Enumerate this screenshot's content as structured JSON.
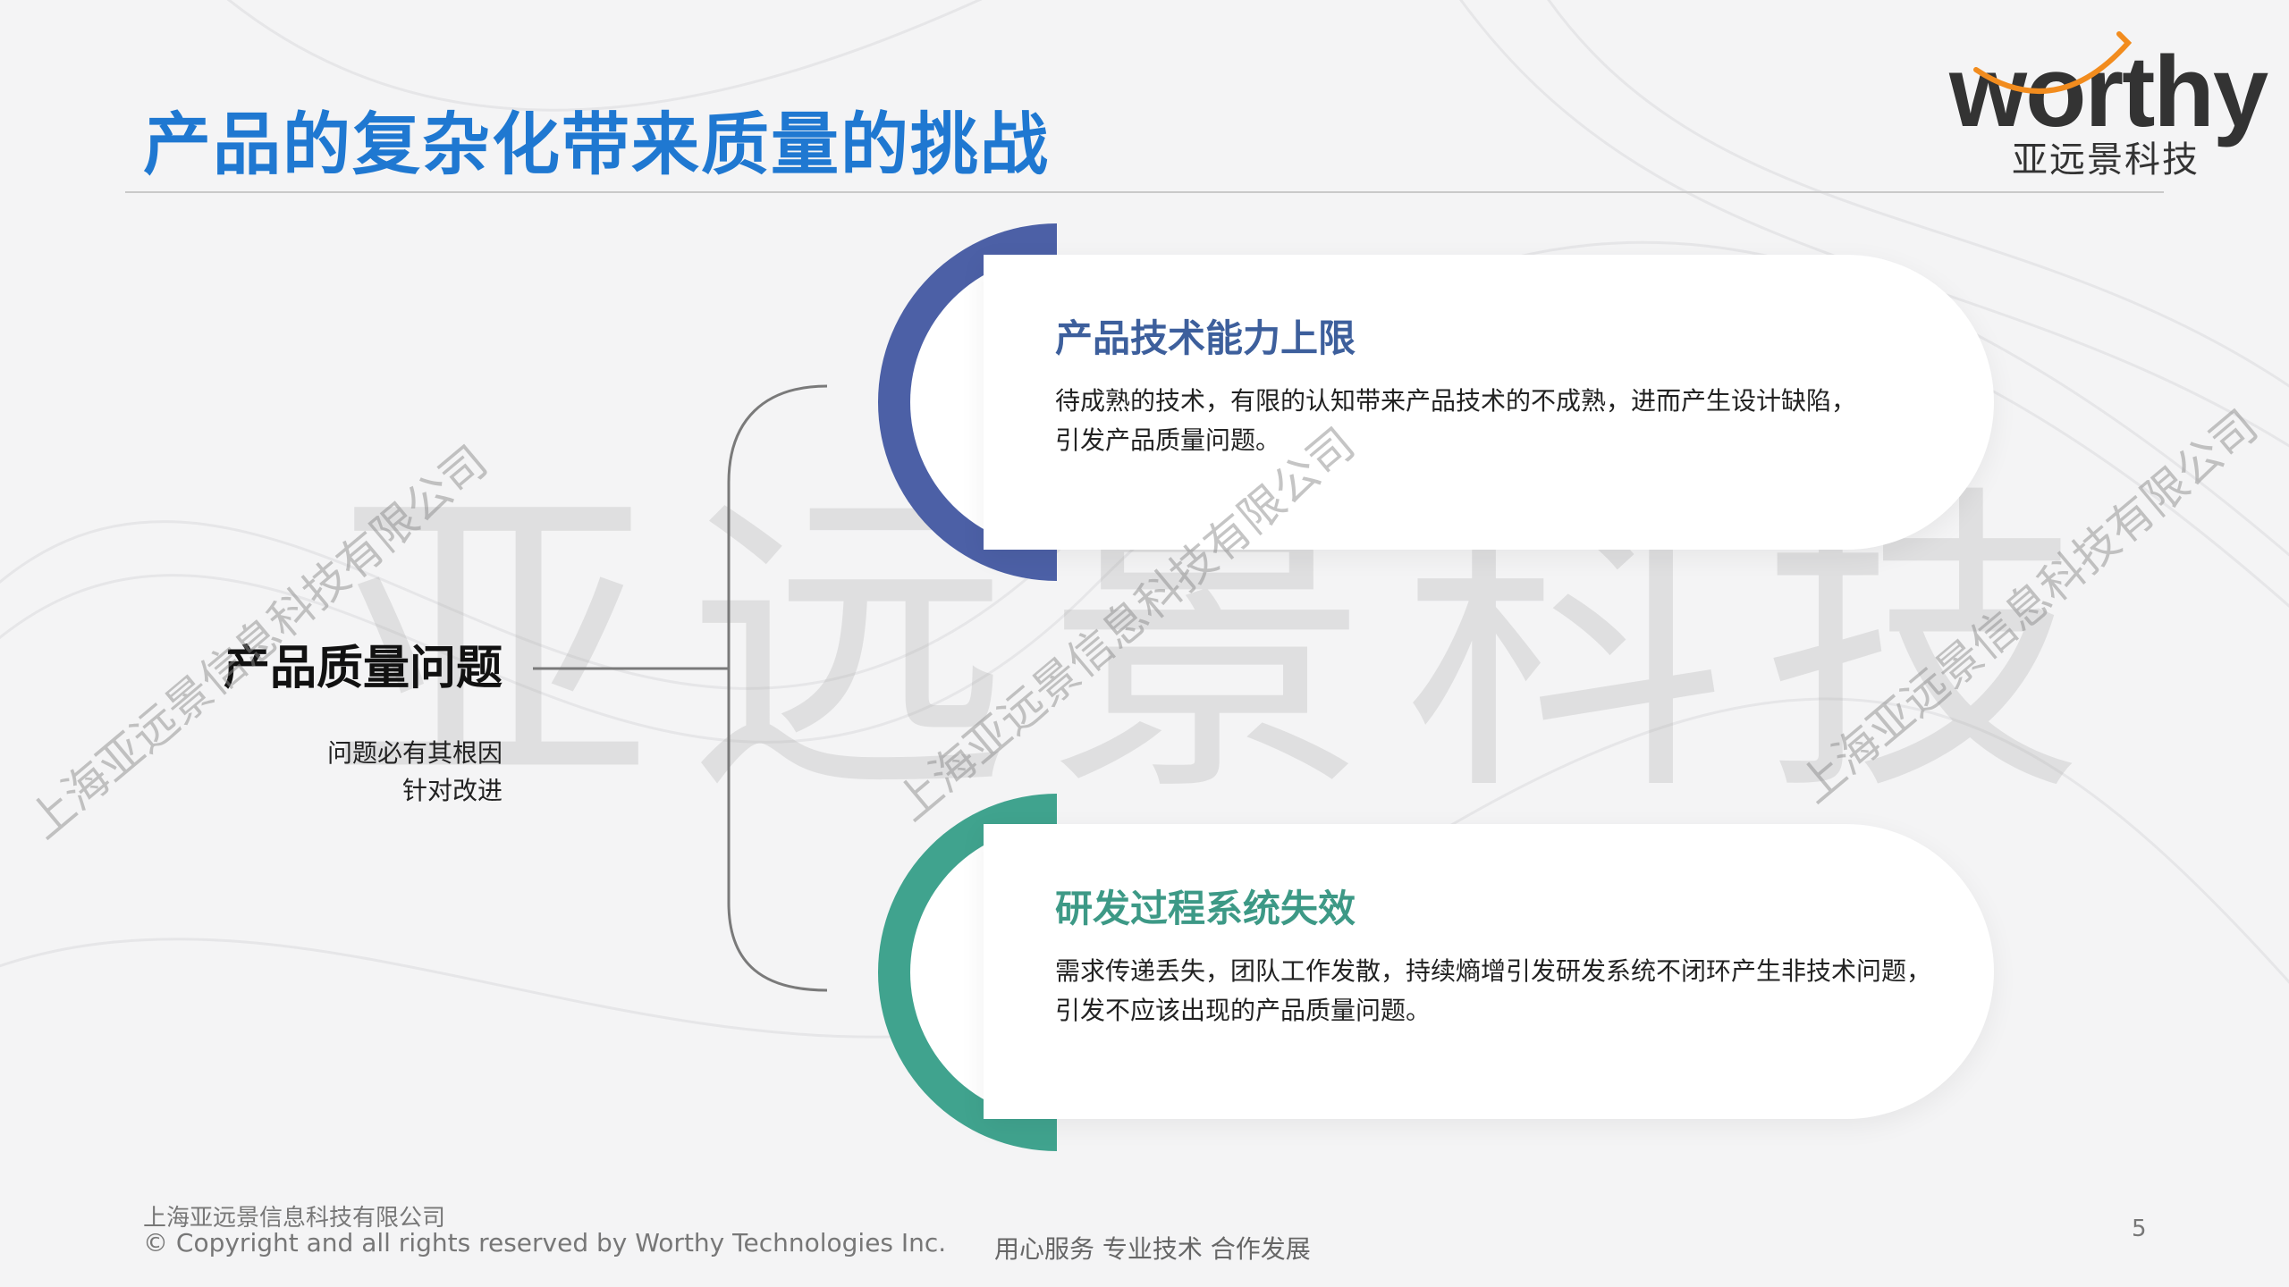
{
  "slide": {
    "title": "产品的复杂化带来质量的挑战",
    "page_number": "5"
  },
  "logo": {
    "wordmark": "worthy",
    "subtitle": "亚远景科技",
    "accent_color": "#f28c1e"
  },
  "watermark": {
    "big_text": "亚远景科技",
    "diagonal_text": "上海亚远景信息科技有限公司"
  },
  "left_panel": {
    "title": "产品质量问题",
    "lines": [
      "问题必有其根因",
      "针对改进"
    ]
  },
  "cards": [
    {
      "title": "产品技术能力上限",
      "lines": [
        "待成熟的技术，有限的认知带来产品技术的不成熟，进而产生设计缺陷，",
        "引发产品质量问题。"
      ],
      "accent_color": "#4c60a6"
    },
    {
      "title": "研发过程系统失效",
      "lines": [
        "需求传递丢失，团队工作发散，持续熵增引发研发系统不闭环产生非技术问题，",
        "引发不应该出现的产品质量问题。"
      ],
      "accent_color": "#40a38e"
    }
  ],
  "footer": {
    "company": "上海亚远景信息科技有限公司",
    "copyright": "© Copyright and all rights reserved by Worthy Technologies Inc.",
    "slogan": "用心服务  专业技术  合作发展"
  }
}
